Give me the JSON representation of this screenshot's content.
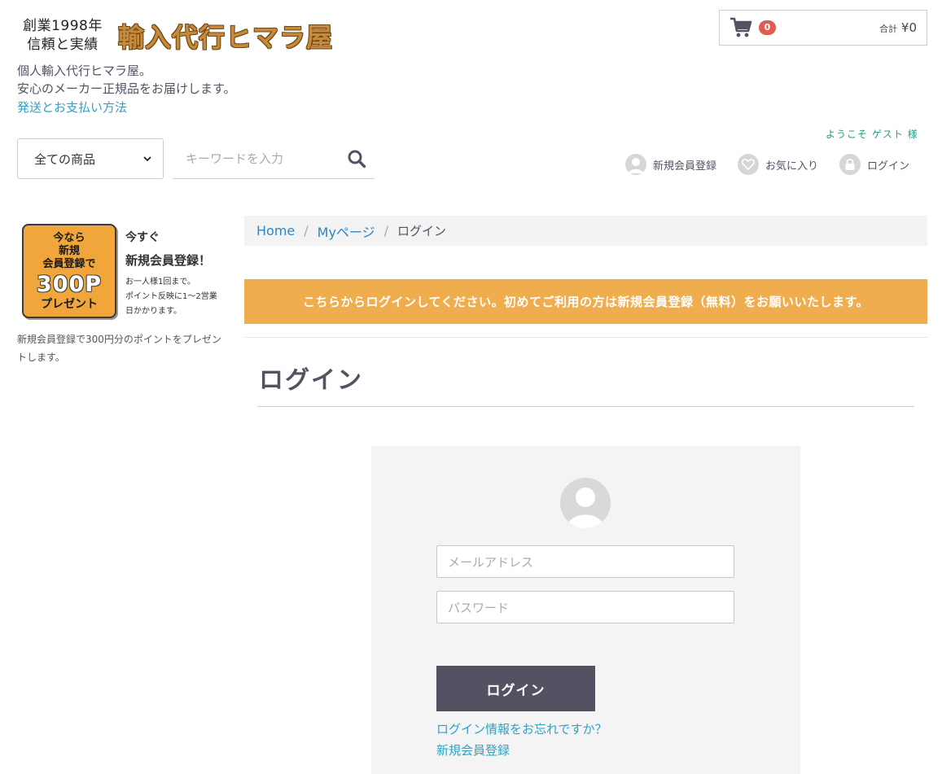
{
  "logo": {
    "line1": "創業1998年",
    "line2": "信頼と実績",
    "brand": "輸入代行ヒマラ屋"
  },
  "tagline": {
    "line1": "個人輸入代行ヒマラ屋。",
    "line2": "安心のメーカー正規品をお届けします。"
  },
  "shipping_link": "発送とお支払い方法",
  "cart": {
    "count": "0",
    "total_label": "合計",
    "total_value": "¥0"
  },
  "welcome": "ようこそ ゲスト 様",
  "search": {
    "category_selected": "全ての商品",
    "keyword_placeholder": "キーワードを入力"
  },
  "member_nav": {
    "register": "新規会員登録",
    "favorites": "お気に入り",
    "login": "ログイン"
  },
  "banner": {
    "box_line1": "今なら",
    "box_line2": "新規",
    "box_line3": "会員登録で",
    "box_points": "300P",
    "box_gift": "プレゼント",
    "text_line1": "今すぐ",
    "text_line2": "新規会員登録！",
    "text_line3": "お一人様1回まで。",
    "text_line4": "ポイント反映に1～2営業",
    "text_line5": "日かかります。"
  },
  "side_note": "新規会員登録で300円分のポイントをプレゼントします。",
  "breadcrumb": {
    "home": "Home",
    "mypage": "Myページ",
    "current": "ログイン",
    "separator": "/"
  },
  "alert": "こちらからログインしてください。初めてご利用の方は新規会員登録（無料）をお願いいたします。",
  "page_title": "ログイン",
  "login_form": {
    "email_placeholder": "メールアドレス",
    "password_placeholder": "パスワード",
    "submit_label": "ログイン",
    "forgot_link": "ログイン情報をお忘れですか？",
    "register_link": "新規会員登録"
  },
  "colors": {
    "accent_link": "#2ea3c6",
    "alert_bg": "#f0ad4e",
    "button_bg": "#525263",
    "badge_bg": "#de5d50"
  }
}
